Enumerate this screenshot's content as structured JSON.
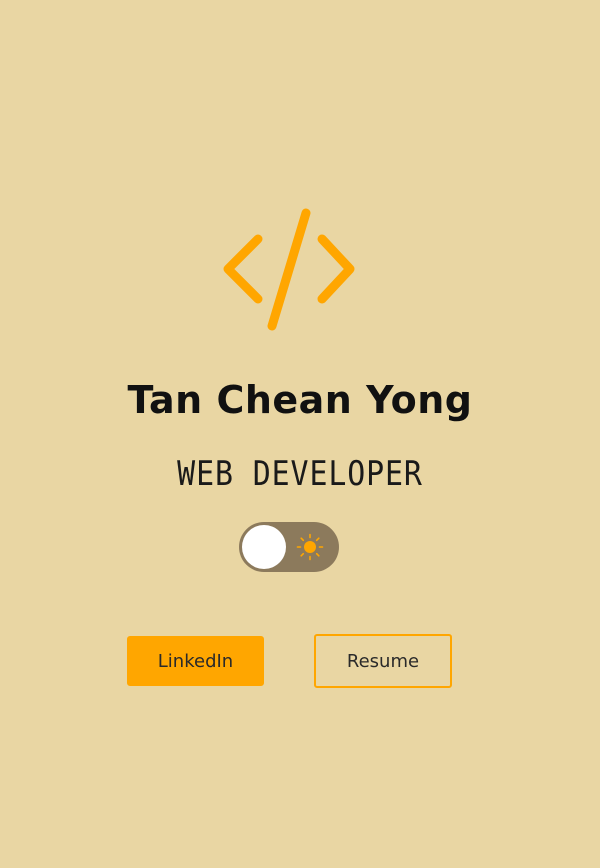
{
  "profile": {
    "name": "Tan Chean Yong",
    "role": "WEB DEVELOPER"
  },
  "logo": {
    "icon": "code-brackets-icon",
    "color": "#ffa600"
  },
  "theme_toggle": {
    "state": "light",
    "icon": "sun-icon"
  },
  "actions": {
    "linkedin_label": "LinkedIn",
    "resume_label": "Resume"
  },
  "colors": {
    "background": "#e9d6a3",
    "accent": "#ffa600",
    "toggle_track": "#8c7a5c"
  }
}
